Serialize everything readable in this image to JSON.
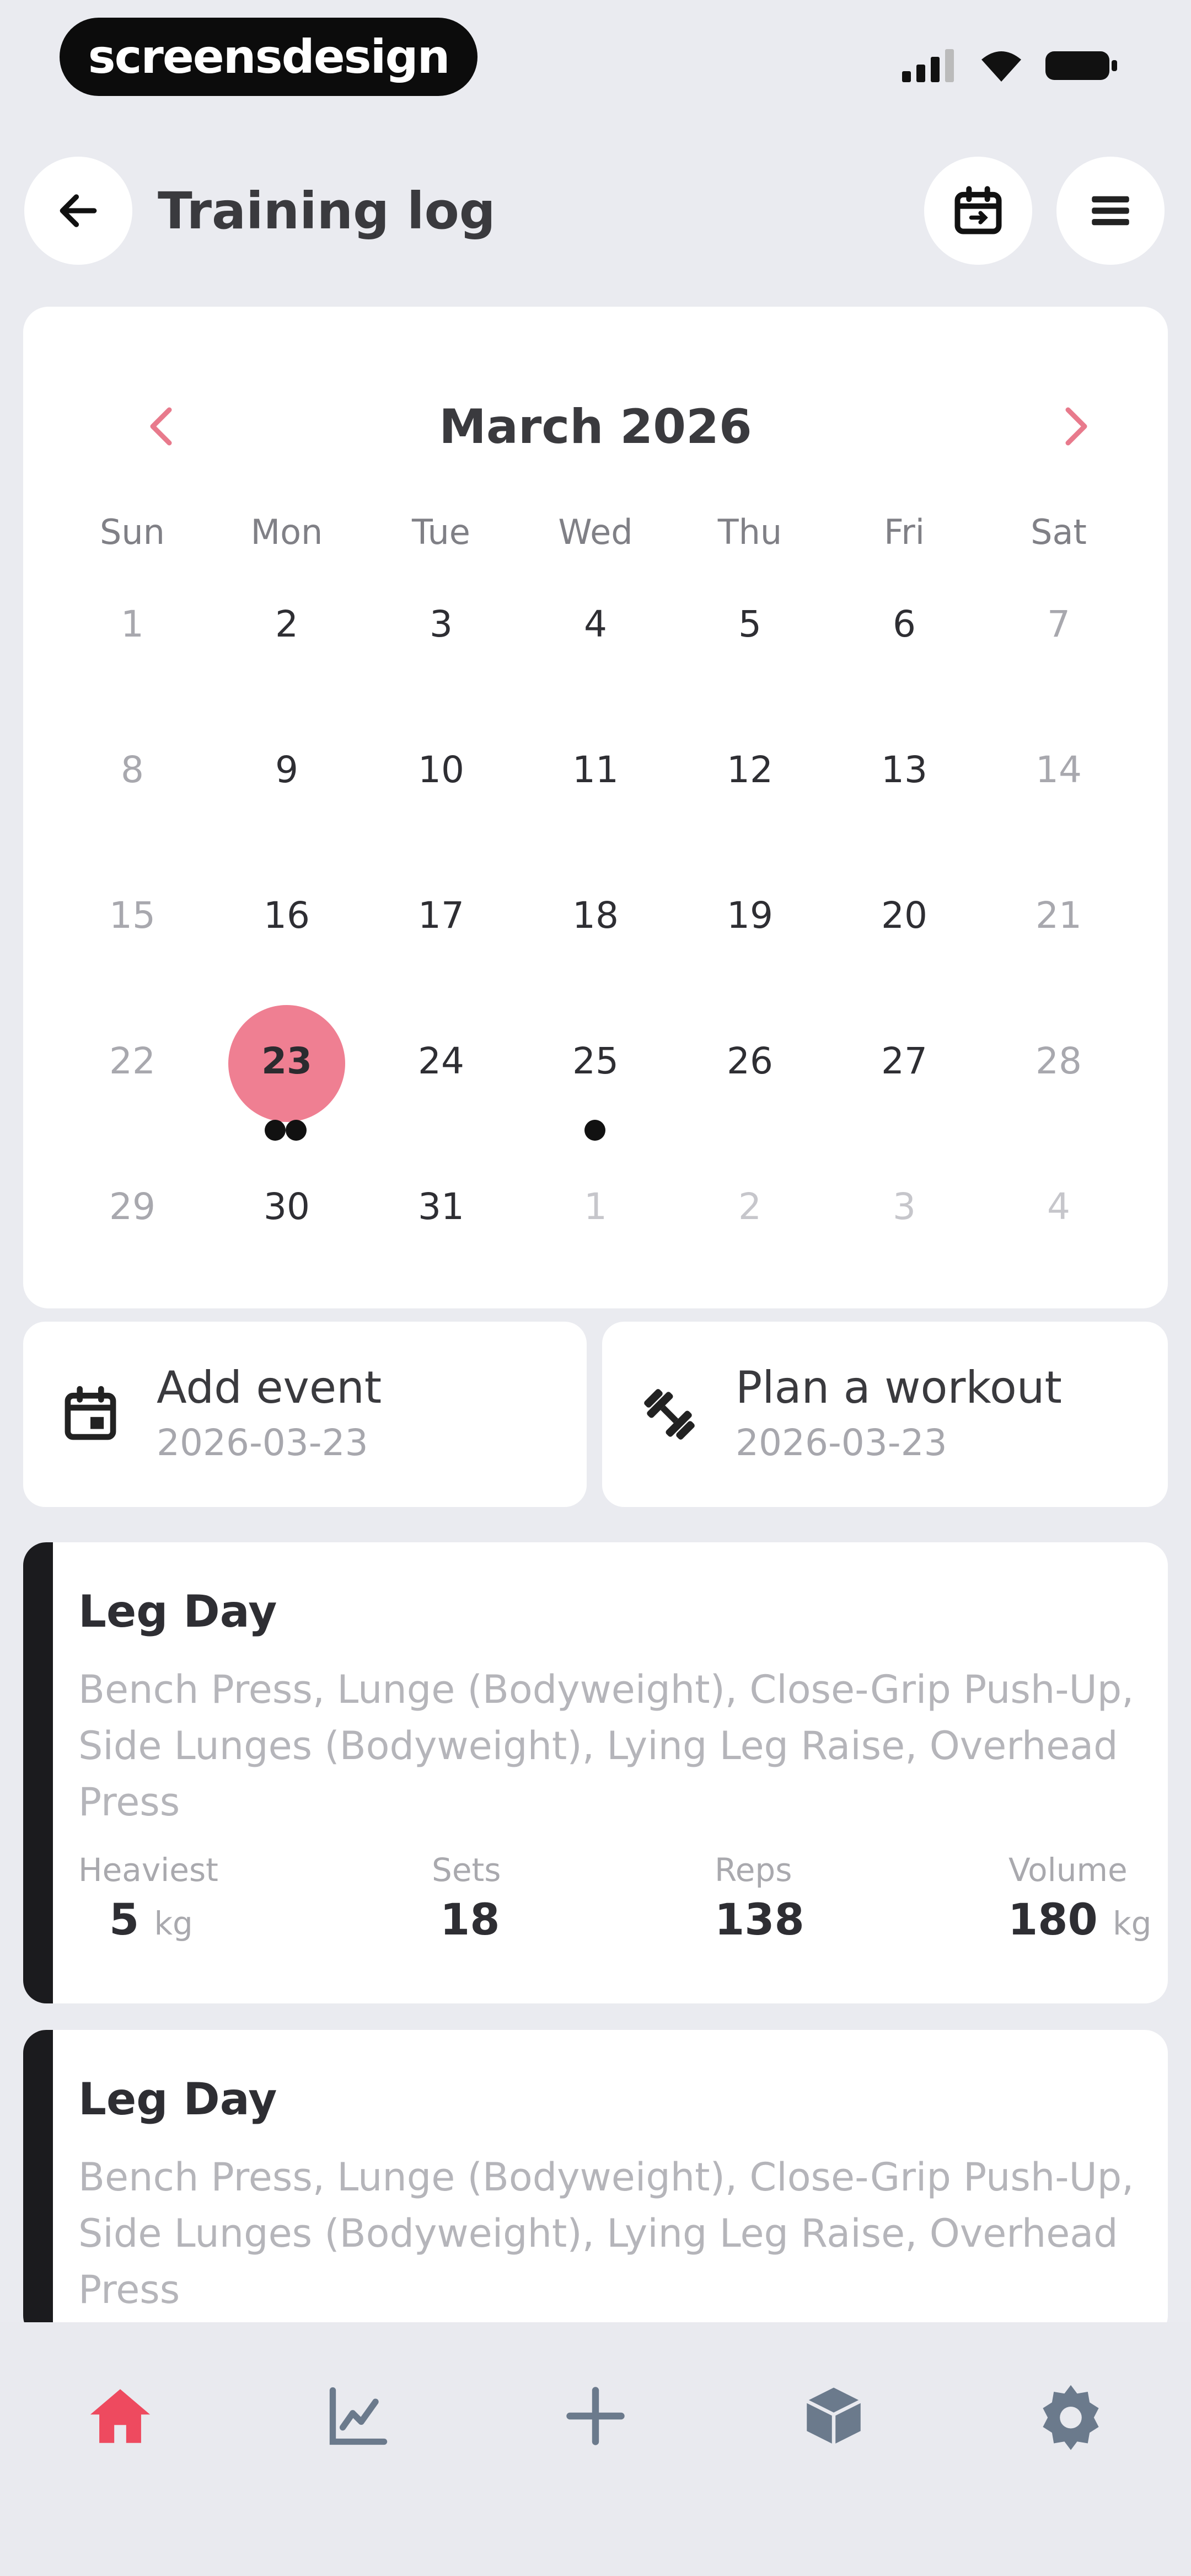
{
  "status_bar": {
    "brand": "screensdesign"
  },
  "header": {
    "title": "Training log"
  },
  "calendar": {
    "month_label": "March 2026",
    "weekdays": [
      "Sun",
      "Mon",
      "Tue",
      "Wed",
      "Thu",
      "Fri",
      "Sat"
    ],
    "weeks": [
      [
        "1",
        "2",
        "3",
        "4",
        "5",
        "6",
        "7"
      ],
      [
        "8",
        "9",
        "10",
        "11",
        "12",
        "13",
        "14"
      ],
      [
        "15",
        "16",
        "17",
        "18",
        "19",
        "20",
        "21"
      ],
      [
        "22",
        "23",
        "24",
        "25",
        "26",
        "27",
        "28"
      ],
      [
        "29",
        "30",
        "31",
        "1",
        "2",
        "3",
        "4"
      ]
    ],
    "selected_day": "23",
    "accent_color": "#ef7f92"
  },
  "actions": {
    "add_event": {
      "label": "Add event",
      "date": "2026-03-23"
    },
    "plan_workout": {
      "label": "Plan a workout",
      "date": "2026-03-23"
    }
  },
  "workouts": [
    {
      "title": "Leg Day",
      "exercises": "Bench Press, Lunge (Bodyweight), Close-Grip Push-Up, Side Lunges (Bodyweight), Lying Leg Raise, Overhead Press",
      "stats": {
        "heaviest_label": "Heaviest",
        "heaviest_value": "5",
        "heaviest_unit": "kg",
        "sets_label": "Sets",
        "sets_value": "18",
        "reps_label": "Reps",
        "reps_value": "138",
        "volume_label": "Volume",
        "volume_value": "180",
        "volume_unit": "kg"
      }
    },
    {
      "title": "Leg Day",
      "exercises": "Bench Press, Lunge (Bodyweight), Close-Grip Push-Up, Side Lunges (Bodyweight), Lying Leg Raise, Overhead Press"
    }
  ],
  "bottom_nav": {
    "items": [
      "home-icon",
      "chart-icon",
      "plus-icon",
      "box-icon",
      "gear-icon"
    ],
    "active_color": "#ee4a5f",
    "inactive_color": "#6b7a8c"
  }
}
